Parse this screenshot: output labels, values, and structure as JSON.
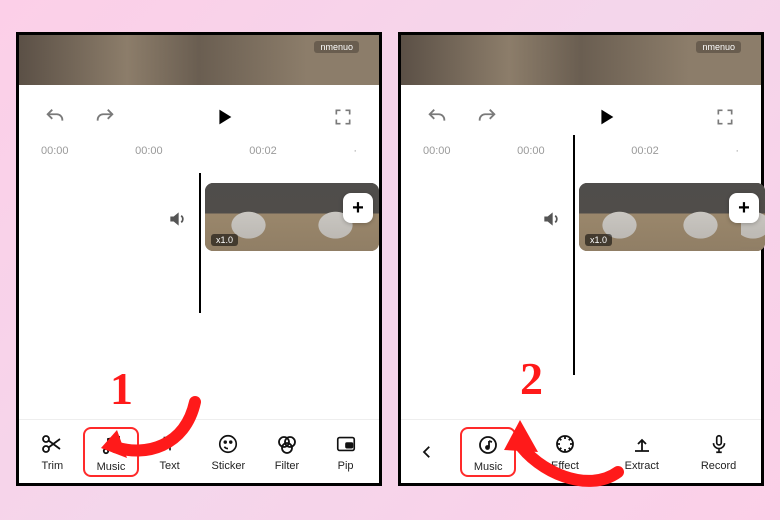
{
  "leftPanel": {
    "previewTag": "nmenuo",
    "timecodes": {
      "start": "00:00",
      "mid": "00:00",
      "end": "00:02"
    },
    "clip": {
      "speed": "x1.0"
    },
    "addLabel": "+",
    "toolbar": {
      "trim": "Trim",
      "music": "Music",
      "text": "Text",
      "sticker": "Sticker",
      "filter": "Filter",
      "pip": "Pip"
    }
  },
  "rightPanel": {
    "previewTag": "nmenuo",
    "timecodes": {
      "start": "00:00",
      "mid": "00:00",
      "end": "00:02"
    },
    "clip": {
      "speed": "x1.0"
    },
    "addLabel": "+",
    "toolbar": {
      "music": "Music",
      "effect": "Effect",
      "extract": "Extract",
      "record": "Record"
    }
  },
  "annotations": {
    "one": "1",
    "two": "2"
  }
}
